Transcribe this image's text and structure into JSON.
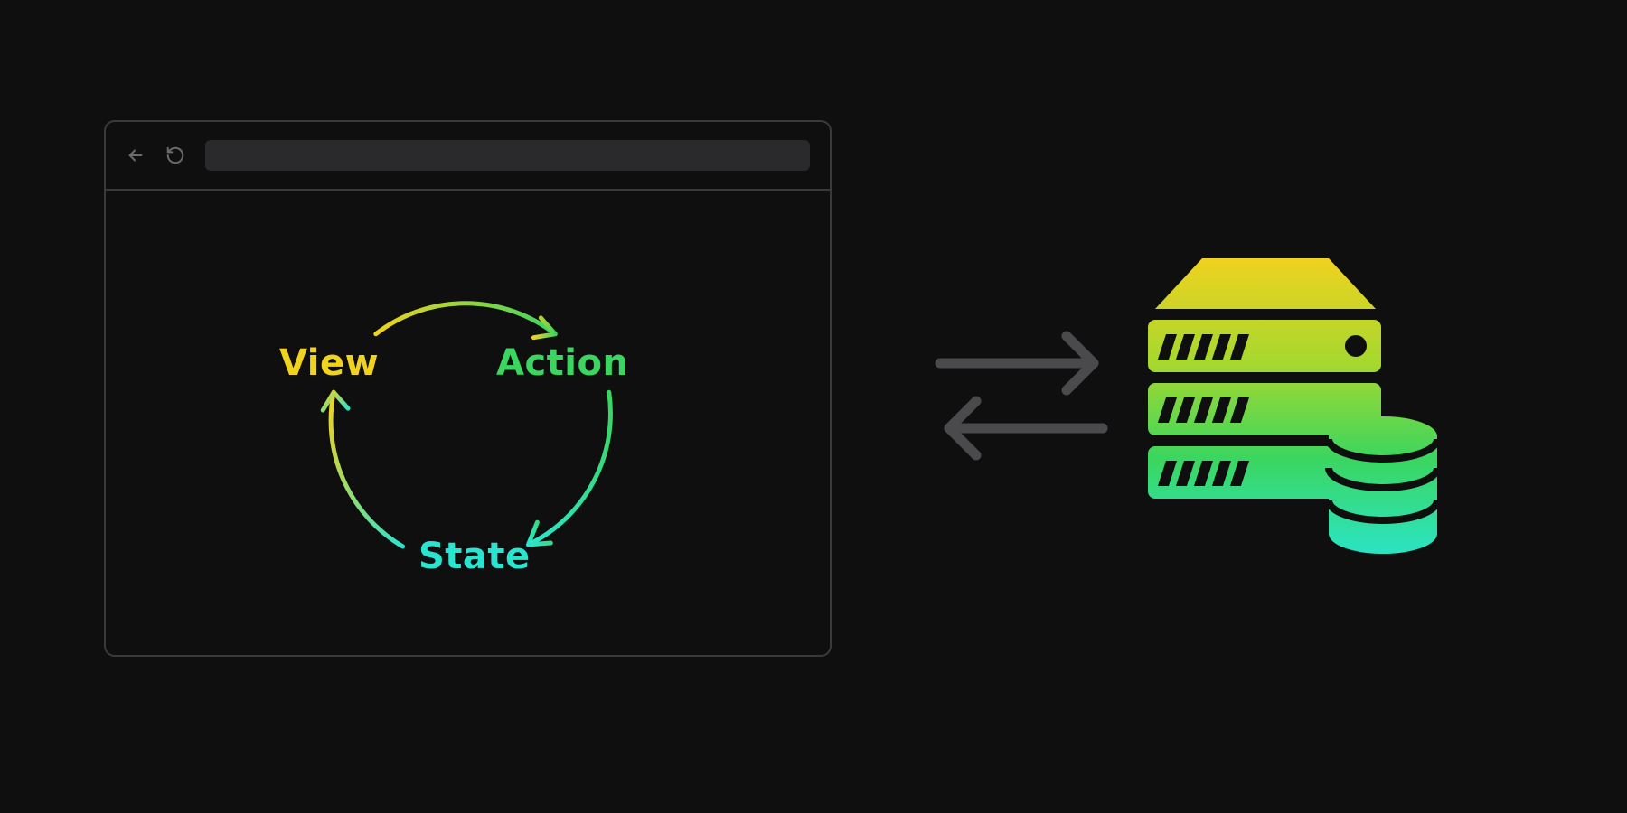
{
  "diagram": {
    "cycle": {
      "nodes": {
        "view": {
          "label": "View",
          "color": "#f0d21f"
        },
        "action": {
          "label": "Action",
          "color": "#3bd65f"
        },
        "state": {
          "label": "State",
          "color": "#29e5d0"
        }
      },
      "arrows": [
        {
          "from": "view",
          "to": "action"
        },
        {
          "from": "action",
          "to": "state"
        },
        {
          "from": "state",
          "to": "view"
        }
      ]
    },
    "exchange": {
      "direction": "bidirectional",
      "arrow_color": "#4a4a4d"
    },
    "server_stack": {
      "icon": "server-stack-icon",
      "gradient": [
        "#f0d21f",
        "#a4d82f",
        "#3bd65f",
        "#29e5d0"
      ]
    },
    "browser": {
      "nav_icons": [
        "back",
        "reload"
      ],
      "address_value": ""
    }
  }
}
